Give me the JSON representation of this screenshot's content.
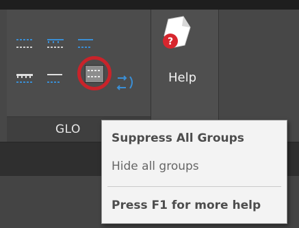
{
  "ribbon": {
    "panel_label": "GLO",
    "help_button_label": "Help",
    "accent_red": "#c9232a",
    "icon_blue": "#3a8fd6"
  },
  "tooltip": {
    "title": "Suppress All Groups",
    "description": "Hide all groups",
    "help_hint": "Press F1 for more help"
  }
}
